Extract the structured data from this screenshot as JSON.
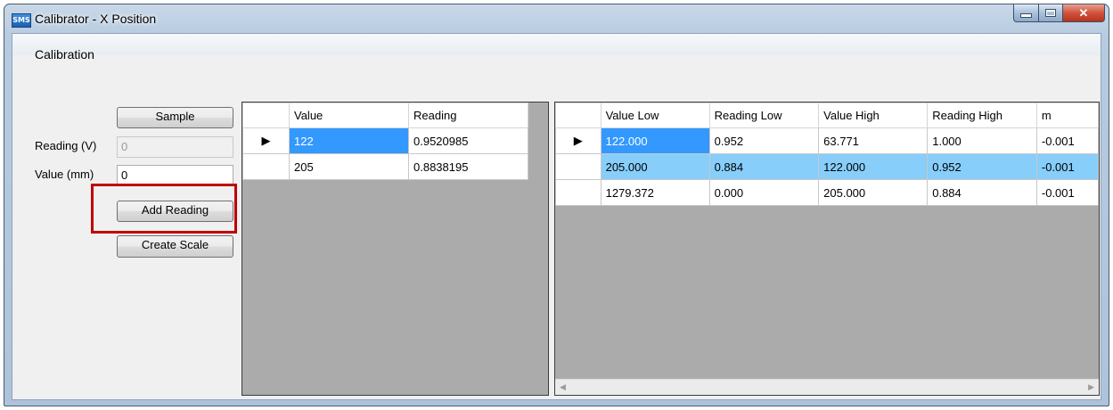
{
  "window": {
    "title": "Calibrator - X Position",
    "app_icon": "SMS"
  },
  "menu": {
    "items": [
      "Calibration"
    ]
  },
  "form": {
    "sample_button": "Sample",
    "reading_label": "Reading (V)",
    "reading_value": "0",
    "value_label": "Value (mm)",
    "value_value": "0",
    "add_reading_button": "Add Reading",
    "create_scale_button": "Create Scale"
  },
  "readings_grid": {
    "columns": [
      "Value",
      "Reading"
    ],
    "rows": [
      [
        "122",
        "0.9520985"
      ],
      [
        "205",
        "0.8838195"
      ]
    ]
  },
  "scale_grid": {
    "columns": [
      "Value Low",
      "Reading Low",
      "Value High",
      "Reading High",
      "m"
    ],
    "rows": [
      [
        "122.000",
        "0.952",
        "63.771",
        "1.000",
        "-0.001"
      ],
      [
        "205.000",
        "0.884",
        "122.000",
        "0.952",
        "-0.001"
      ],
      [
        "1279.372",
        "0.000",
        "205.000",
        "0.884",
        "-0.001"
      ]
    ]
  },
  "colors": {
    "selected": "#3399ff",
    "alternate_selected": "#87cefa",
    "highlight_box": "#c00000",
    "grid_background": "#ababab"
  }
}
